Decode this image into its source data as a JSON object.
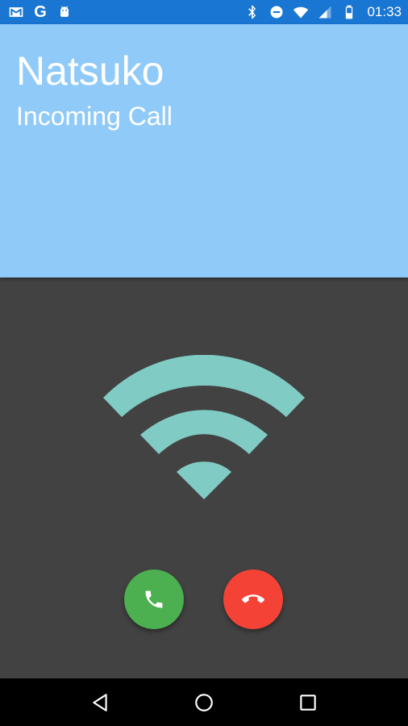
{
  "status_bar": {
    "left_icons": [
      "gmail-icon",
      "google-icon",
      "android-icon"
    ],
    "google_letter": "G",
    "right_icons": [
      "bluetooth-icon",
      "do-not-disturb-icon",
      "wifi-signal-icon",
      "cell-signal-icon",
      "battery-icon"
    ],
    "time": "01:33"
  },
  "call": {
    "caller_name": "Natsuko",
    "status": "Incoming Call"
  },
  "graphic": {
    "icon": "wifi-icon",
    "color": "#80cbc4"
  },
  "actions": {
    "answer": {
      "icon": "phone-icon",
      "color": "#4caf50"
    },
    "decline": {
      "icon": "hang-up-icon",
      "color": "#f44336"
    }
  },
  "colors": {
    "status_bar": "#1976d2",
    "header": "#90caf9",
    "background": "#424242",
    "nav_bar": "#000000"
  },
  "nav_bar": {
    "items": [
      "back-icon",
      "home-icon",
      "recents-icon"
    ]
  }
}
